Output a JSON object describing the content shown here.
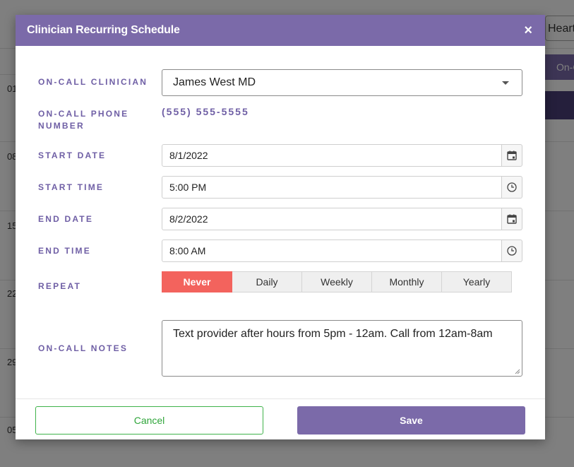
{
  "background": {
    "day_labels": [
      "01",
      "08",
      "15",
      "22",
      "29",
      "05"
    ],
    "header_select_text": "Heart",
    "side_button_text": "On-C"
  },
  "modal": {
    "title": "Clinician Recurring Schedule",
    "close_label": "×",
    "fields": {
      "clinician": {
        "label": "ON-CALL CLINICIAN",
        "value": "James West MD"
      },
      "phone": {
        "label_line1": "ON-CALL PHONE",
        "label_line2": "NUMBER",
        "value": "(555) 555-5555"
      },
      "start_date": {
        "label": "START DATE",
        "value": "8/1/2022"
      },
      "start_time": {
        "label": "START TIME",
        "value": "5:00 PM"
      },
      "end_date": {
        "label": "END DATE",
        "value": "8/2/2022"
      },
      "end_time": {
        "label": "END TIME",
        "value": "8:00 AM"
      },
      "repeat": {
        "label": "REPEAT",
        "options": [
          "Never",
          "Daily",
          "Weekly",
          "Monthly",
          "Yearly"
        ],
        "selected": "Never"
      },
      "notes": {
        "label": "ON-CALL NOTES",
        "value": "Text provider after hours from 5pm - 12am. Call from 12am-8am"
      }
    },
    "footer": {
      "cancel_label": "Cancel",
      "save_label": "Save"
    }
  },
  "colors": {
    "header": "#7b6aa9",
    "label": "#6f5fa5",
    "repeat_active": "#f3635d",
    "cancel_border": "#3fb24a"
  }
}
